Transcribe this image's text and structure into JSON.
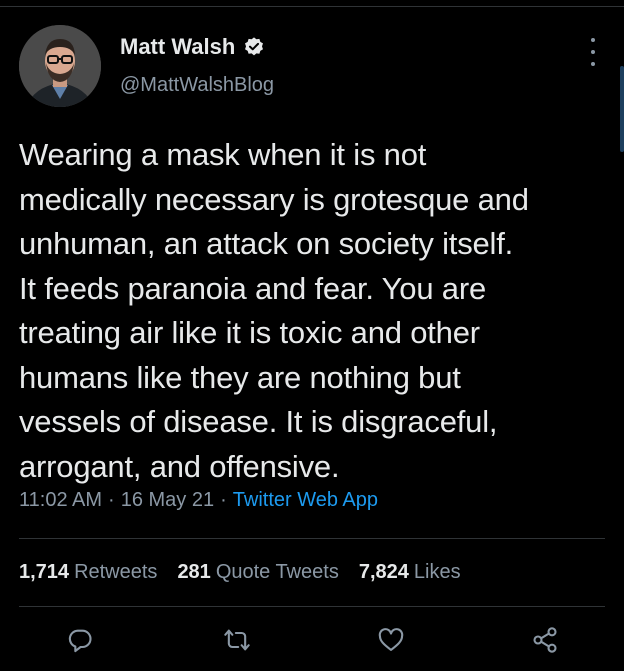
{
  "tweet": {
    "author_name": "Matt Walsh",
    "handle": "@MattWalshBlog",
    "text": "Wearing a mask when it is not\nmedically necessary is grotesque and\nunhuman, an attack on society itself.\nIt feeds paranoia and fear. You are\ntreating air like it is toxic and other\nhumans like they are nothing but\nvessels of disease. It is disgraceful,\narrogant, and offensive.",
    "time": "11:02 AM",
    "separator": "·",
    "date": "16 May 21",
    "source": "Twitter Web App"
  },
  "stats": {
    "retweets_count": "1,714",
    "retweets_label": "Retweets",
    "quotes_count": "281",
    "quotes_label": "Quote Tweets",
    "likes_count": "7,824",
    "likes_label": "Likes"
  },
  "icons": {
    "verified": "verified-badge-icon",
    "more": "more-options-icon",
    "reply": "reply-icon",
    "retweet": "retweet-icon",
    "like": "heart-icon",
    "share": "share-icon"
  },
  "colors": {
    "background": "#000000",
    "text": "#e7e9ea",
    "muted": "#8b98a5",
    "link": "#1d9bf0",
    "divider": "#2f3336"
  }
}
